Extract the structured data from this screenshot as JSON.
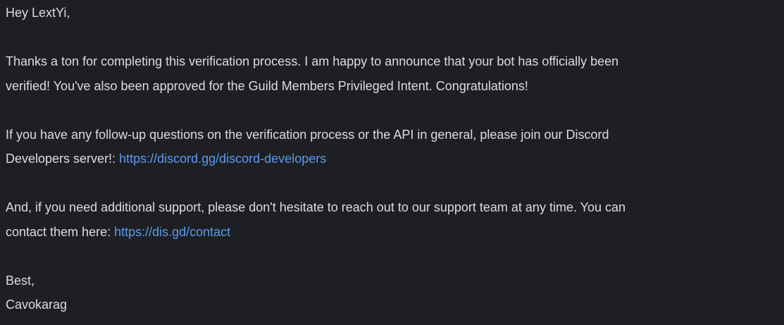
{
  "email": {
    "greeting": "Hey LextYi,",
    "paragraph1": {
      "line1": "Thanks a ton for completing this verification process. I am happy to announce that your bot has officially been",
      "line2": "verified! You've also been approved for the Guild Members Privileged Intent. Congratulations!"
    },
    "paragraph2": {
      "line1": "If you have any follow-up questions on the verification process or the API in general, please join our Discord",
      "line2_prefix": "Developers server!: ",
      "link_text": "https://discord.gg/discord-developers"
    },
    "paragraph3": {
      "line1": "And, if you need additional support, please don't hesitate to reach out to our support team at any time. You can",
      "line2_prefix": "contact them here: ",
      "link_text": "https://dis.gd/contact"
    },
    "signoff": "Best,",
    "signature": "Cavokarag"
  },
  "colors": {
    "background": "#1e1f22",
    "text": "#dcddde",
    "link": "#5b9bf0"
  }
}
